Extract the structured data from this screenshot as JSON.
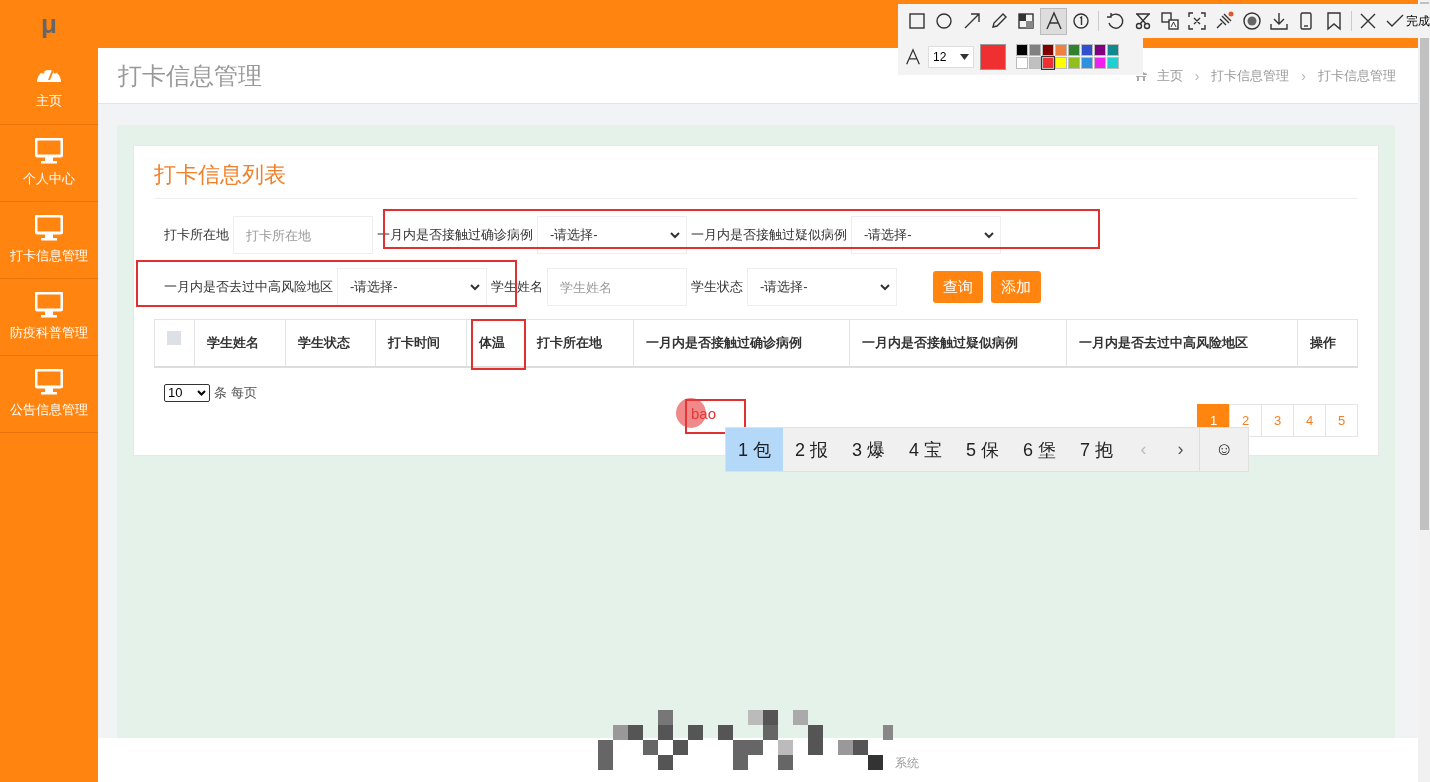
{
  "sidebar": {
    "logo": "μ",
    "items": [
      {
        "label": "主页",
        "kind": "dashboard"
      },
      {
        "label": "个人中心",
        "kind": "monitor"
      },
      {
        "label": "打卡信息管理",
        "kind": "monitor"
      },
      {
        "label": "防疫科普管理",
        "kind": "monitor"
      },
      {
        "label": "公告信息管理",
        "kind": "monitor"
      }
    ]
  },
  "header": {
    "title": "打卡信息管理",
    "breadcrumb": [
      {
        "kind": "link",
        "text": "主页"
      },
      {
        "kind": "separator",
        "text": "›"
      },
      {
        "kind": "link",
        "text": "打卡信息管理"
      },
      {
        "kind": "separator",
        "text": "›"
      },
      {
        "kind": "link",
        "text": "打卡信息管理"
      }
    ]
  },
  "card": {
    "title": "打卡信息列表",
    "filter_rows": [
      [
        {
          "label": "打卡所在地",
          "kind": "input",
          "placeholder": "打卡所在地"
        },
        {
          "label": "一月内是否接触过确诊病例",
          "kind": "select",
          "value": "-请选择-"
        },
        {
          "label": "一月内是否接触过疑似病例",
          "kind": "select",
          "value": "-请选择-"
        }
      ],
      [
        {
          "label": "一月内是否去过中高风险地区",
          "kind": "select",
          "value": "-请选择-"
        },
        {
          "label": "学生姓名",
          "kind": "input",
          "placeholder": "学生姓名"
        },
        {
          "label": "学生状态",
          "kind": "select",
          "value": "-请选择-"
        }
      ]
    ],
    "buttons": [
      "查询",
      "添加"
    ],
    "table": {
      "select_all_checked": false,
      "columns": [
        "学生姓名",
        "学生状态",
        "打卡时间",
        "体温",
        "打卡所在地",
        "一月内是否接触过确诊病例",
        "一月内是否接触过疑似病例",
        "一月内是否去过中高风险地区",
        "操作"
      ]
    },
    "page_size": "10",
    "page_size_label": "条 每页",
    "pages": [
      {
        "label": "1",
        "selected": true
      },
      {
        "label": "2",
        "selected": false
      },
      {
        "label": "3",
        "selected": false
      },
      {
        "label": "4",
        "selected": false
      },
      {
        "label": "5",
        "selected": false
      }
    ]
  },
  "footer": {
    "text": "系统"
  },
  "annotations": [
    {
      "kind": "rect"
    },
    {
      "kind": "rect"
    },
    {
      "kind": "rect"
    },
    {
      "kind": "text",
      "text": "bao"
    }
  ],
  "ime": {
    "candidates": [
      {
        "label": "1 包",
        "selected": true
      },
      {
        "label": "2 报",
        "selected": false
      },
      {
        "label": "3 爆",
        "selected": false
      },
      {
        "label": "4 宝",
        "selected": false
      },
      {
        "label": "5 保",
        "selected": false
      },
      {
        "label": "6 堡",
        "selected": false
      },
      {
        "label": "7 抱",
        "selected": false
      }
    ],
    "prev": "‹",
    "next": "›",
    "emoji": "☺"
  },
  "capture_toolbar": {
    "tools": [
      {
        "kind": "rect",
        "selected": false
      },
      {
        "kind": "circle",
        "selected": false
      },
      {
        "kind": "arrow",
        "selected": false
      },
      {
        "kind": "pencil",
        "selected": false
      },
      {
        "kind": "mosaic",
        "selected": false
      },
      {
        "kind": "text",
        "selected": true
      },
      {
        "kind": "number",
        "selected": false
      },
      {
        "kind": "undo",
        "selected": false
      },
      {
        "kind": "cut",
        "selected": false
      },
      {
        "kind": "translate",
        "selected": false
      },
      {
        "kind": "ocr",
        "selected": false
      },
      {
        "kind": "pin",
        "selected": false
      },
      {
        "kind": "record",
        "selected": false
      },
      {
        "kind": "download",
        "selected": false
      },
      {
        "kind": "phone",
        "selected": false
      },
      {
        "kind": "bookmark",
        "selected": false
      },
      {
        "kind": "close",
        "selected": false
      }
    ],
    "done": "完成",
    "font_size": "12",
    "palette": [
      {
        "color": "#000000",
        "selected": false
      },
      {
        "color": "#808080",
        "selected": false
      },
      {
        "color": "#800000",
        "selected": false
      },
      {
        "color": "#f08040",
        "selected": false
      },
      {
        "color": "#308030",
        "selected": false
      },
      {
        "color": "#3050d0",
        "selected": false
      },
      {
        "color": "#800080",
        "selected": false
      },
      {
        "color": "#108890",
        "selected": false
      },
      {
        "color": "#ffffff",
        "selected": false
      },
      {
        "color": "#c0c0c0",
        "selected": false
      },
      {
        "color": "#f03030",
        "selected": true
      },
      {
        "color": "#ffff00",
        "selected": false
      },
      {
        "color": "#90c020",
        "selected": false
      },
      {
        "color": "#3090e0",
        "selected": false
      },
      {
        "color": "#f020f0",
        "selected": false
      },
      {
        "color": "#20d0d0",
        "selected": false
      }
    ]
  }
}
